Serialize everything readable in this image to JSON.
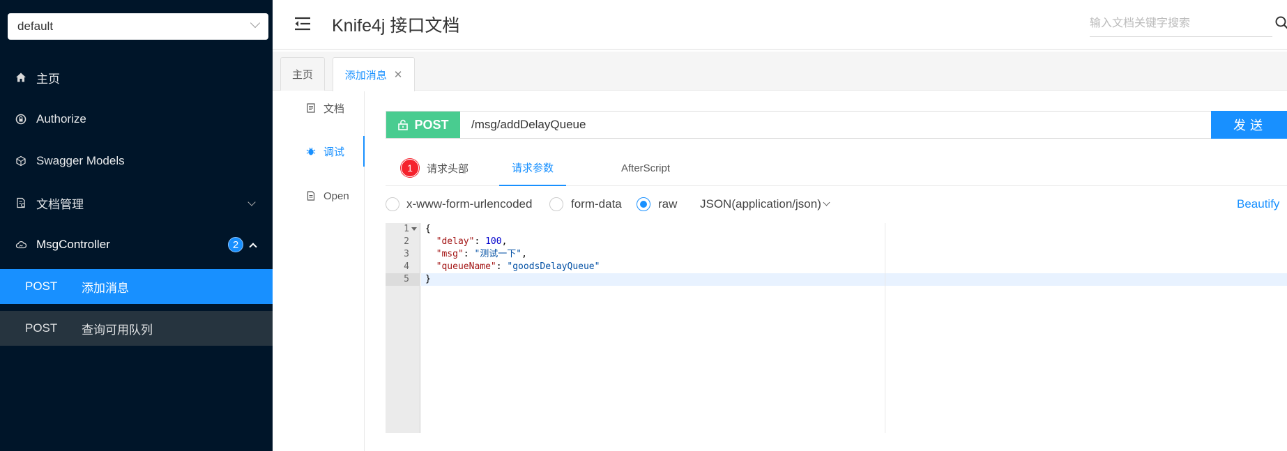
{
  "sidebar": {
    "group_select": "default",
    "menu": [
      {
        "label": "主页",
        "icon": "home-icon"
      },
      {
        "label": "Authorize",
        "icon": "lock-icon"
      },
      {
        "label": "Swagger Models",
        "icon": "models-icon"
      },
      {
        "label": "文档管理",
        "icon": "doc-manage-icon"
      },
      {
        "label": "MsgController",
        "icon": "cloud-icon",
        "badge": "2"
      }
    ],
    "apis": [
      {
        "method": "POST",
        "summary": "添加消息",
        "active": true
      },
      {
        "method": "POST",
        "summary": "查询可用队列",
        "active": false
      }
    ]
  },
  "header": {
    "title": "Knife4j 接口文档",
    "search_placeholder": "输入文档关键字搜索"
  },
  "tabs": [
    {
      "label": "主页"
    },
    {
      "label": "添加消息",
      "close": "✕"
    }
  ],
  "doc_nav": [
    {
      "label": "文档"
    },
    {
      "label": "调试"
    },
    {
      "label": "Open"
    }
  ],
  "request": {
    "method": "POST",
    "url": "/msg/addDelayQueue",
    "send_label": "发送"
  },
  "param_tabs": {
    "headers_badge": "1",
    "headers_label": "请求头部",
    "params_label": "请求参数",
    "after_script_label": "AfterScript"
  },
  "body_types": {
    "urlencoded": "x-www-form-urlencoded",
    "form_data": "form-data",
    "raw": "raw",
    "content_type": "JSON(application/json)",
    "beautify": "Beautify"
  },
  "editor": {
    "line_numbers": [
      "1",
      "2",
      "3",
      "4",
      "5"
    ],
    "lines": {
      "l1": "{",
      "l2_key": "\"delay\"",
      "l2_val": "100",
      "l3_key": "\"msg\"",
      "l3_val": "\"测试一下\"",
      "l4_key": "\"queueName\"",
      "l4_val": "\"goodsDelayQueue\"",
      "l5": "}"
    }
  },
  "colors": {
    "sidebar_bg": "#001529",
    "accent": "#1890ff",
    "post_green": "#49cc90",
    "badge_red": "#f5222d"
  }
}
